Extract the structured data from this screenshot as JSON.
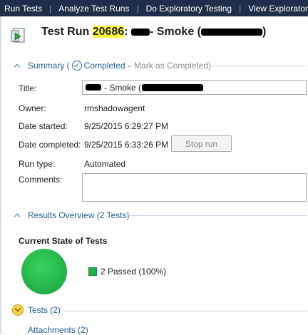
{
  "nav": [
    "Run Tests",
    "Analyze Test Runs",
    "Do Exploratory Testing",
    "View Exploratory"
  ],
  "header": {
    "prefix": "Test Run ",
    "run_id": "20686",
    "colon": ":",
    "suffix": "- Smoke (",
    "end": ")"
  },
  "summary": {
    "label": "Summary (",
    "completed": "Completed -",
    "mark": "Mark as Completed)"
  },
  "fields": {
    "title_label": "Title:",
    "title_value_suffix": "- Smoke (",
    "owner_label": "Owner:",
    "owner_value": "rmshadowagent",
    "date_started_label": "Date started:",
    "date_started_value": "9/25/2015 6:29:27 PM",
    "date_completed_label": "Date completed:",
    "date_completed_value": "9/25/2015 6:33:26 PM",
    "stop_run": "Stop run",
    "run_type_label": "Run type:",
    "run_type_value": "Automated",
    "comments_label": "Comments:"
  },
  "results": {
    "section": "Results Overview (2 Tests)",
    "subtitle": "Current State of Tests",
    "legend": "2 Passed (100%)",
    "passed_fraction": 1.0
  },
  "tests_section": "Tests (2)",
  "attachments_section": "Attachments (2)",
  "colors": {
    "passed": "#22b04c",
    "highlight": "#ffff3c",
    "nav_bg": "#1f2f4a",
    "link": "#1f5c9b"
  }
}
